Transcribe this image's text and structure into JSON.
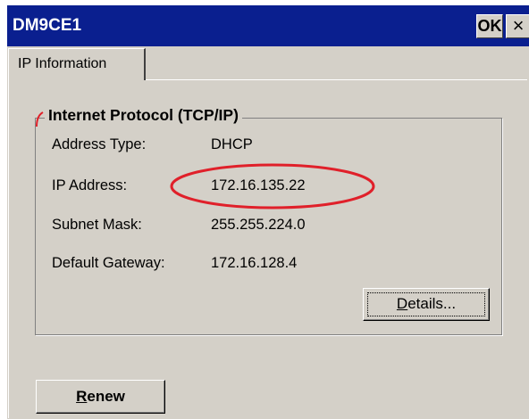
{
  "window": {
    "title": "DM9CE1",
    "ok_label": "OK",
    "close_glyph": "×"
  },
  "tabs": [
    {
      "label": "IP Information",
      "selected": true
    }
  ],
  "group": {
    "title": "Internet Protocol (TCP/IP)"
  },
  "fields": [
    {
      "label": "Address Type:",
      "value": "DHCP"
    },
    {
      "label": "IP Address:",
      "value": "172.16.135.22"
    },
    {
      "label": "Subnet Mask:",
      "value": "255.255.224.0"
    },
    {
      "label": "Default Gateway:",
      "value": "172.16.128.4"
    }
  ],
  "buttons": {
    "details": {
      "accel": "D",
      "rest": "etails..."
    },
    "renew": {
      "accel": "R",
      "rest": "enew"
    }
  },
  "colors": {
    "titlebar": "#0a1f8f",
    "face": "#d4d0c8",
    "annotation": "#e0202a"
  }
}
